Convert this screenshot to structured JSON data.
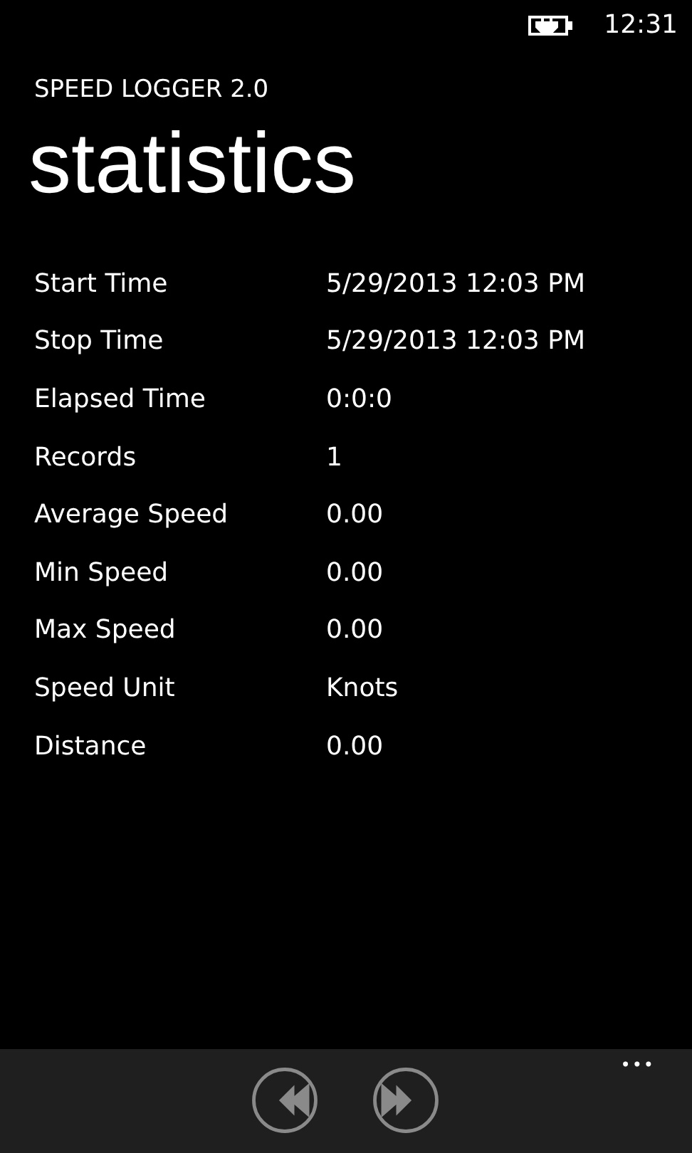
{
  "status_bar": {
    "time": "12:31"
  },
  "app_title": "SPEED LOGGER 2.0",
  "page_title": "statistics",
  "rows": [
    {
      "label": "Start Time",
      "value": "5/29/2013 12:03 PM"
    },
    {
      "label": "Stop Time",
      "value": "5/29/2013 12:03 PM"
    },
    {
      "label": "Elapsed Time",
      "value": "0:0:0"
    },
    {
      "label": "Records",
      "value": "1"
    },
    {
      "label": "Average Speed",
      "value": "0.00"
    },
    {
      "label": "Min Speed",
      "value": "0.00"
    },
    {
      "label": "Max Speed",
      "value": "0.00"
    },
    {
      "label": "Speed Unit",
      "value": "Knots"
    },
    {
      "label": "Distance",
      "value": "0.00"
    }
  ],
  "app_bar": {
    "buttons": [
      {
        "kind": "previous",
        "disabled": true
      },
      {
        "kind": "next",
        "disabled": true
      }
    ],
    "more": "•••"
  }
}
